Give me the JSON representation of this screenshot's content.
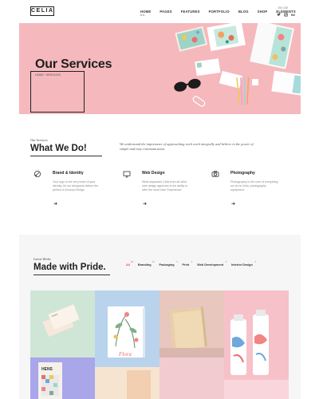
{
  "header": {
    "logo": "CELIA",
    "nav": [
      {
        "label": "HOME",
        "sub": "RTL"
      },
      {
        "label": "PAGES"
      },
      {
        "label": "FEATURES"
      },
      {
        "label": "PORTFOLIO"
      },
      {
        "label": "BLOG"
      },
      {
        "label": "SHOP"
      },
      {
        "label": "ELEMENTS"
      }
    ],
    "lang": "EN  |  DE",
    "socials": [
      "twitter-icon",
      "instagram-icon",
      "behance-icon"
    ]
  },
  "hero": {
    "title": "Our Services",
    "breadcrumb": "HOME  /  SERVICES",
    "background_color": "#f5b8bd"
  },
  "what_we_do": {
    "eyebrow": "Our Services",
    "title": "What We Do!",
    "intro": "We understand the importance of approaching each work integrally and believe in the power of simple and easy communication.",
    "services": [
      {
        "icon": "brush-icon",
        "title": "Brand & Identity",
        "text": "Your logo is the very heart of your identity, let our designers deliver the perfect & Armony Design."
      },
      {
        "icon": "monitor-icon",
        "title": "Web Design",
        "text": "What separates Celia from all other web design agencies is the ability to offer the most User Experience."
      },
      {
        "icon": "camera-icon",
        "title": "Photography",
        "text": "Photography is the core of everything we do at Celia, photography equipment."
      }
    ]
  },
  "works": {
    "eyebrow": "Latest Works",
    "title": "Made with Pride.",
    "filters": [
      {
        "label": "All",
        "count": "19",
        "active": true
      },
      {
        "label": "Branding",
        "count": "10"
      },
      {
        "label": "Packaging",
        "count": "4"
      },
      {
        "label": "Print",
        "count": "2"
      },
      {
        "label": "Web Development",
        "count": "4"
      },
      {
        "label": "Interior Design",
        "count": "3"
      }
    ],
    "tiles": [
      {
        "name": "business-cards-mint"
      },
      {
        "name": "floral-book-cover",
        "text": "Flora"
      },
      {
        "name": "beige-notebook"
      },
      {
        "name": "cosmetic-tubes-pink"
      },
      {
        "name": "notebook-purple",
        "text": "HENS"
      }
    ],
    "accent_color": "#e24a4a"
  }
}
